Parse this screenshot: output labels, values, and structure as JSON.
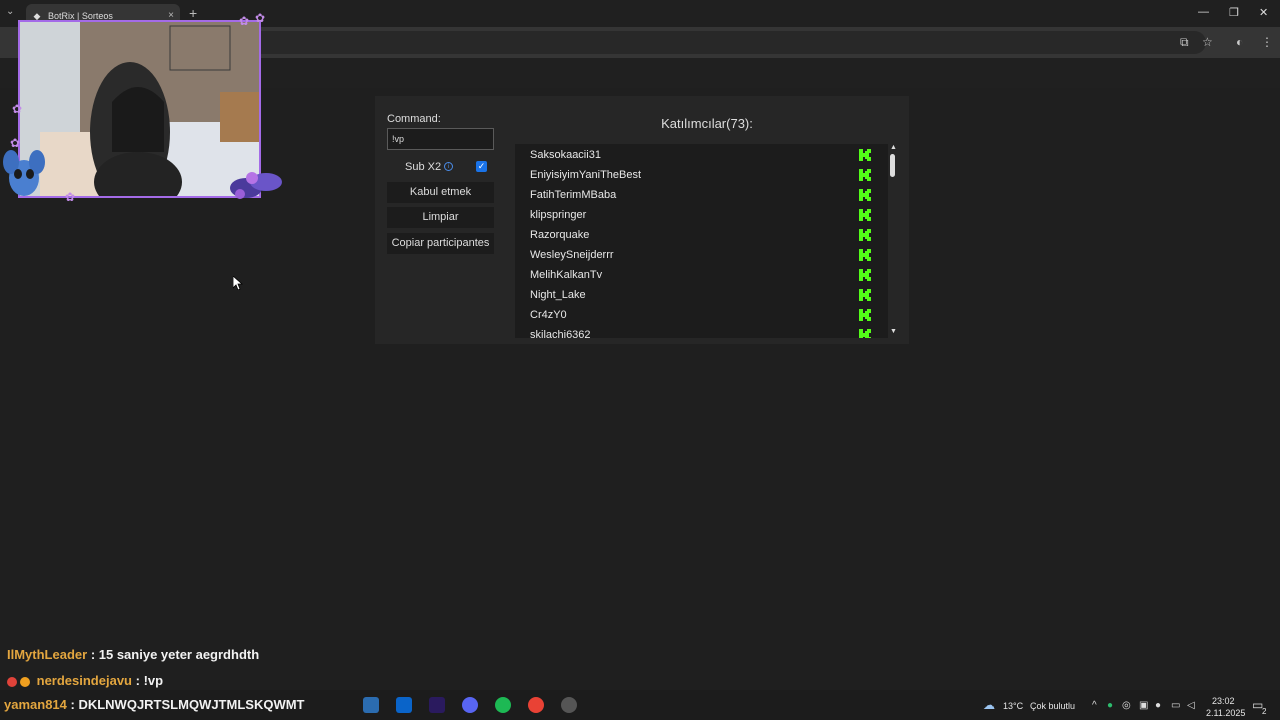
{
  "browser": {
    "tab_title": "BotRix | Sorteos",
    "tab_close": "×",
    "new_tab": "+",
    "minimize": "—",
    "restore": "❐",
    "close": "✕"
  },
  "giveaway": {
    "command_label": "Command:",
    "command_value": "!vp",
    "sub_label": "Sub X2",
    "sub_checked": true,
    "accept_button": "Kabul etmek",
    "clear_button": "Limpiar",
    "copy_button": "Copiar participantes",
    "list_title": "Katılımcılar(73):",
    "participants": [
      "Saksokaacii31",
      "EniyisiyimYaniTheBest",
      "FatihTerimMBaba",
      "klipspringer",
      "Razorquake",
      "WesleySneijderrr",
      "MelihKalkanTv",
      "Night_Lake",
      "Cr4zY0",
      "skilachi6362"
    ],
    "platform_icon": "kick-icon",
    "accent_color": "#53fc18"
  },
  "chat": [
    {
      "user": "IlMythLeader",
      "message": ": 15 saniye yeter aegrdhdth"
    },
    {
      "user": "nerdesindejavu",
      "message": ": !vp"
    }
  ],
  "taskbar": {
    "ticker_user": "yaman814",
    "ticker_message": ": DKLNWQJRTSLMQWJTMLSKQWMT",
    "weather": "13°C",
    "weather_desc": "Çok bulutlu",
    "time": "23:02",
    "date": "2.11.2025",
    "notifications": "2"
  }
}
